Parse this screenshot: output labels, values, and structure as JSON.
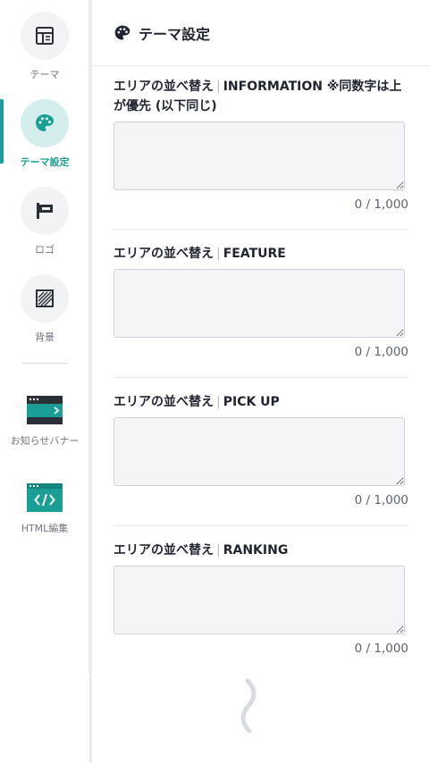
{
  "sidebar": {
    "items": [
      {
        "label": "テーマ",
        "icon": "layout-icon"
      },
      {
        "label": "テーマ設定",
        "icon": "palette-icon",
        "active": true
      },
      {
        "label": "ロゴ",
        "icon": "flag-sign-icon"
      },
      {
        "label": "背景",
        "icon": "pattern-icon"
      }
    ],
    "banners": [
      {
        "label": "お知らせバナー",
        "icon": "notice-banner-icon"
      },
      {
        "label": "HTML編集",
        "icon": "code-window-icon"
      }
    ]
  },
  "header": {
    "title": "テーマ設定",
    "icon": "palette-icon"
  },
  "sections": [
    {
      "label": "エリアの並べ替え",
      "area": "INFORMATION ※同数字は上が優先 (以下同じ)",
      "value": "",
      "counter": "0 / 1,000"
    },
    {
      "label": "エリアの並べ替え",
      "area": "FEATURE",
      "value": "",
      "counter": "0 / 1,000"
    },
    {
      "label": "エリアの並べ替え",
      "area": "PICK UP",
      "value": "",
      "counter": "0 / 1,000"
    },
    {
      "label": "エリアの並べ替え",
      "area": "RANKING",
      "value": "",
      "counter": "0 / 1,000"
    }
  ],
  "colors": {
    "accent": "#1a9e95",
    "accent_light": "#d3eeec",
    "field_bg": "#f4f5f7"
  }
}
